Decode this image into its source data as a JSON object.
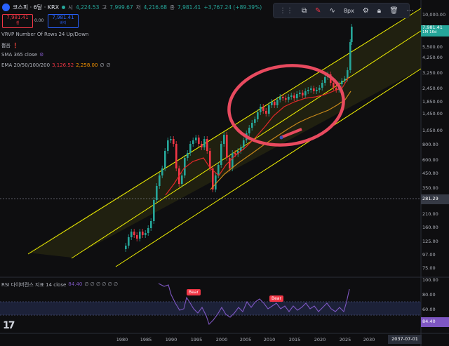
{
  "header": {
    "symbol": "코스피 · 6달 · KRX",
    "open_label": "시",
    "open_value": "4,224.53",
    "high_label": "고",
    "high_value": "7,999.67",
    "low_label": "저",
    "low_value": "4,216.68",
    "close_label": "종",
    "close_value": "7,981.41",
    "change_value": "+3,767.24 (+89.39%)"
  },
  "trade": {
    "sell_price": "7,981.41",
    "sell_label": "셀",
    "spread": "0.00",
    "buy_price": "7,981.41",
    "buy_label": "바이"
  },
  "indicators": {
    "vrvp": "VRVP Number Of Rows 24 Up/Down",
    "bulletin": "뽑음",
    "sma": "SMA 365 close",
    "ema_label": "EMA 20/50/100/200",
    "ema_v1": "3,126.52",
    "ema_v2": "2,258.00",
    "ema_v3": "∅",
    "ema_v4": "∅"
  },
  "toolbar": {
    "stroke_width": "8px"
  },
  "price_axis": {
    "labels": [
      "10,000.00",
      "5,500.00",
      "4,250.00",
      "3,250.00",
      "2,450.00",
      "1,850.00",
      "1,450.00",
      "1,050.00",
      "800.00",
      "600.00",
      "450.00",
      "350.00",
      "210.00",
      "160.00",
      "125.00",
      "97.00",
      "75.00"
    ],
    "current_price": "7,981.41",
    "current_tf": "1M 16d",
    "crosshair_price": "281.29"
  },
  "rsi": {
    "title": "RSI 다이버전스 지표 14 close",
    "value": "84.40",
    "bear_label": "Bear",
    "axis": [
      "100.00",
      "80.00",
      "60.00",
      "40.00"
    ]
  },
  "time_axis": {
    "labels": [
      "1980",
      "1985",
      "1990",
      "1995",
      "2000",
      "2005",
      "2010",
      "2015",
      "2020",
      "2025",
      "2030"
    ],
    "crosshair_date": "2037-07-01"
  },
  "colors": {
    "up": "#26a69a",
    "down": "#f23645",
    "channel": "#f0f000",
    "ema_fast": "#e02828",
    "ema_slow": "#c98a1a",
    "rsi": "#7e57c2",
    "annotation": "#e84a5f"
  },
  "chart_data": {
    "type": "candlestick",
    "x_range": [
      "1978",
      "2037"
    ],
    "y_scale": "log",
    "y_range": [
      75,
      10000
    ],
    "last_close": 7981.41,
    "crosshair_price": 281.29,
    "rsi_range": [
      40,
      100
    ],
    "rsi_last": 84.4
  }
}
